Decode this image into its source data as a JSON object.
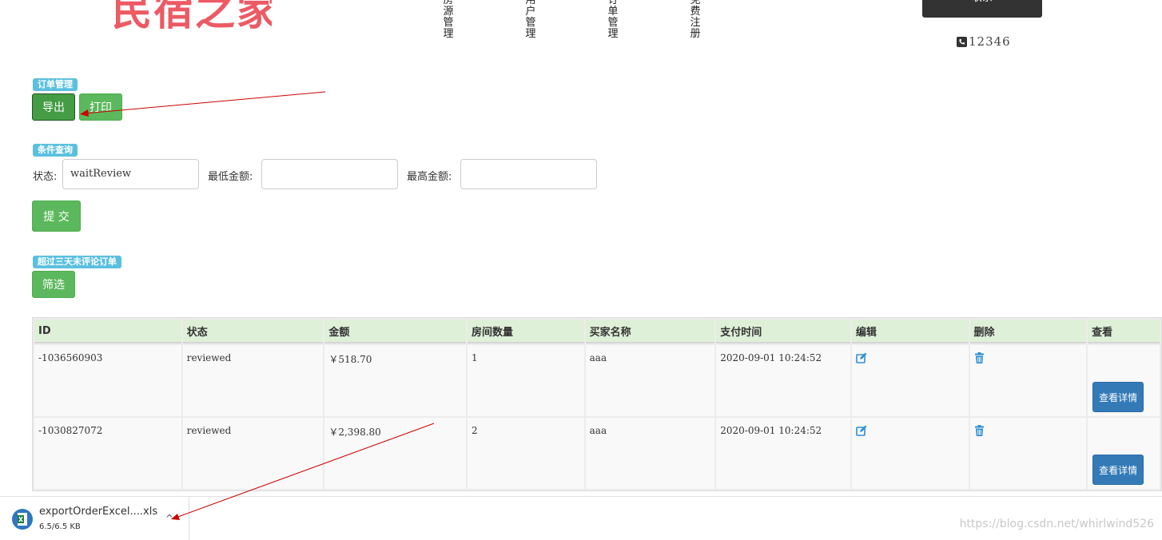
{
  "header": {
    "logo_text": "民宿之家",
    "nav": [
      "房源管理",
      "用户管理",
      "订单管理",
      "免费注册"
    ],
    "contact_label": "联系",
    "phone": "12346"
  },
  "order_section": {
    "badge": "订单管理",
    "export_label": "导出",
    "print_label": "打印"
  },
  "query_section": {
    "badge": "条件查询",
    "status_label": "状态:",
    "status_value": "waitReview",
    "min_label": "最低金额:",
    "min_value": "",
    "max_label": "最高金额:",
    "max_value": "",
    "submit_label": "提 交"
  },
  "filter_section": {
    "badge": "超过三天未评论订单",
    "filter_label": "筛选"
  },
  "table": {
    "headers": [
      "ID",
      "状态",
      "金额",
      "房间数量",
      "买家名称",
      "支付时间",
      "编辑",
      "删除",
      "查看"
    ],
    "rows": [
      {
        "id": "-1036560903",
        "status": "reviewed",
        "amount": "￥518.70",
        "rooms": "1",
        "buyer": "aaa",
        "paid_at": "2020-09-01 10:24:52",
        "view_label": "查看详情"
      },
      {
        "id": "-1030827072",
        "status": "reviewed",
        "amount": "￥2,398.80",
        "rooms": "2",
        "buyer": "aaa",
        "paid_at": "2020-09-01 10:24:52",
        "view_label": "查看详情"
      }
    ]
  },
  "download": {
    "filename": "exportOrderExcel....xls",
    "size": "6.5/6.5 KB"
  },
  "watermark": "https://blog.csdn.net/whirlwind526",
  "colors": {
    "logo": "#ec5a64",
    "success": "#5cb85c",
    "info": "#5bc0de",
    "primary": "#337ab7",
    "annotation": "#cc0000"
  }
}
